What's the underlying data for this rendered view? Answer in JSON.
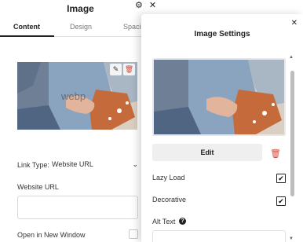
{
  "editor": {
    "title": "Image",
    "tabs": [
      {
        "label": "Content",
        "active": true
      },
      {
        "label": "Design",
        "active": false
      },
      {
        "label": "Spaci",
        "active": false
      }
    ],
    "image_preview_watermark": "webp",
    "link_type_label": "Link Type:",
    "link_type_value": "Website URL",
    "website_url_label": "Website URL",
    "website_url_value": "",
    "open_new_window_label": "Open in New Window",
    "open_new_window_checked": false
  },
  "modal": {
    "title": "Image Settings",
    "edit_label": "Edit",
    "options": [
      {
        "label": "Lazy Load",
        "checked": true
      },
      {
        "label": "Decorative",
        "checked": true
      }
    ],
    "alt_text_label": "Alt Text",
    "alt_text_value": ""
  },
  "icons": {
    "gear": "gear-icon",
    "close": "close-icon",
    "pencil": "pencil-icon",
    "trash": "trash-icon",
    "help": "help-icon",
    "chevron": "chevron-down-icon"
  },
  "colors": {
    "accent": "#222222",
    "delete_red": "#d0463c",
    "button_bg": "#efefef"
  }
}
